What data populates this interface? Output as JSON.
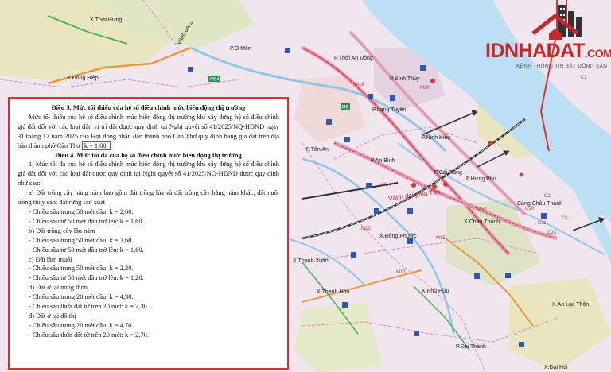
{
  "map_labels": {
    "thoi_hung": "X.Thới Hưng",
    "vanh_dai": "Vành đai 2",
    "p_o_mon": "P.Ô Môn",
    "p_thoi_an_dong": "P.Thới An Đông",
    "p_binh_thuy": "P.Bình Thủy",
    "p_long_tuyen": "P.Long Tuyền",
    "p_ninh_kieu": "P.Ninh Kiều",
    "p_tan_an": "P.Tân An",
    "p_an_binh": "P.An Bình",
    "p_cai_rang": "P.Cái Răng",
    "p_hung_phu": "P.Hưng Phú",
    "vanh_dai_phia_tay": "Vành đai phía Tây",
    "dong_hiep": "X.Đông Hiệp",
    "x_chau_thanh": "X.Châu Thành",
    "x_dong_phuoc": "X.Đông Phước",
    "x_thanh_xuan": "X.Thạnh Xuân",
    "x_phu_huu": "X.Phú Hữu",
    "x_thanh_hoa": "X.Thạnh Hòa",
    "x_an_lac_thon": "X.An Lạc Thôn",
    "p_dai_thanh": "P.Đại Thành",
    "x_dai_hai": "X.Đại Hải",
    "cang_chau_thanh": "Cảng Châu Thành"
  },
  "road_codes": [
    "M10",
    "M12",
    "M13",
    "M14",
    "M15",
    "M16",
    "M50",
    "C1",
    "C2",
    "C3",
    "C10",
    "C11",
    "C13"
  ],
  "logo": {
    "name": "IDNHADAT",
    "suffix": ".COM",
    "tagline": "KÊNH THÔNG TIN BẤT ĐỘNG SẢN"
  },
  "document": {
    "art3_title": "Điều 3. Mức tối thiểu của hệ số điều chỉnh mức biến động thị trường",
    "art3_body": "Mức tối thiểu của hệ số điều chỉnh mức biến động thị trường khi xây dựng hệ số điều chỉnh giá đất đối với các loại đất, vị trí đất được quy định tại Nghị quyết số 41/2025/NQ-HĐND ngày 31 tháng 12 năm 2025 của Hội đồng nhân dân thành phố Cần Thơ quy định bảng giá đất trên địa bàn thành phố Cần Thơ",
    "art3_k": "k = 1,00.",
    "art4_title": "Điều 4. Mức tối đa của hệ số điều chỉnh mức biến động thị trường",
    "art4_intro": "1. Mức tối đa của hệ số điều chỉnh mức biến động thị trường khi xây dựng hệ số điều chỉnh giá đất đối với các loại đất được quy định tại Nghị quyết số 41/2025/NQ-HĐND được quy định như sau:",
    "a_title": "a) Đất trồng cây hằng năm bao gồm đất trồng lúa và đất trồng cây hằng năm khác; đất nuôi trồng thủy sản; đất rừng sản xuất",
    "a1": "- Chiều sâu trong 50 mét đầu: k = 2,60.",
    "a2": "- Chiều sâu từ 50 mét đầu trở lên: k = 1,60.",
    "b_title": "b) Đất trồng cây lâu năm",
    "b1": "- Chiều sâu trong 50 mét đầu: k = 2,60.",
    "b2": "- Chiều sâu từ 50 mét đầu trở lên: k = 1,60.",
    "c_title": "c) Đất làm muối",
    "c1": "- Chiều sâu trong 50 mét đầu: k = 2,20.",
    "c2": "- Chiều sâu từ 50 mét đầu trở lên: k = 1,20.",
    "d_title": "d) Đất ở tại nông thôn",
    "d1": "- Chiều sâu trong 20 mét đầu: k = 4,30.",
    "d2": "- Chiều sâu thừa đất từ trên 20 mét: k = 2,30.",
    "dd_title": "đ) Đất ở tại đô thị",
    "dd1": "- Chiều sâu trong 20 mét đầu: k = 4,70.",
    "dd2": "- Chiều sâu thừa đất từ trên 20 mét: k = 2,70."
  }
}
